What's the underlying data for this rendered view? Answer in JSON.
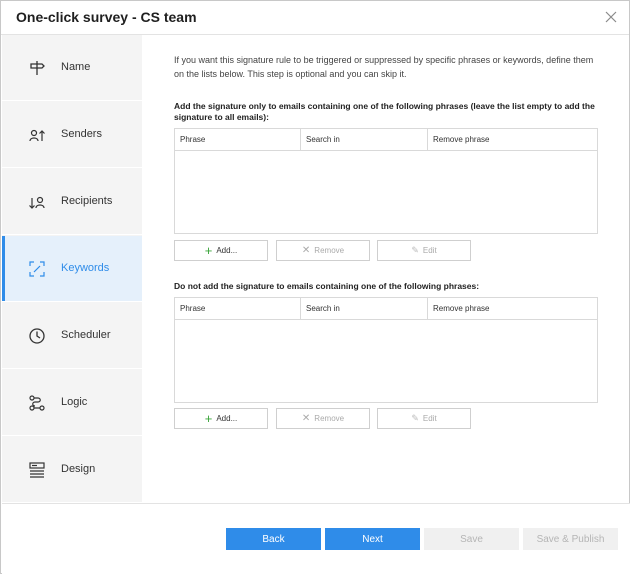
{
  "window": {
    "title": "One-click survey - CS team"
  },
  "sidebar": {
    "items": [
      {
        "label": "Name",
        "icon": "signpost-icon",
        "active": false
      },
      {
        "label": "Senders",
        "icon": "senders-icon",
        "active": false
      },
      {
        "label": "Recipients",
        "icon": "recipients-icon",
        "active": false
      },
      {
        "label": "Keywords",
        "icon": "keywords-icon",
        "active": true
      },
      {
        "label": "Scheduler",
        "icon": "clock-icon",
        "active": false
      },
      {
        "label": "Logic",
        "icon": "logic-icon",
        "active": false
      },
      {
        "label": "Design",
        "icon": "design-icon",
        "active": false
      }
    ]
  },
  "main": {
    "intro": "If you want this signature rule to be triggered or suppressed by specific phrases or keywords, define them on the lists below. This step is optional and you can skip it.",
    "include_section": {
      "title": "Add the signature only to emails containing one of the following phrases (leave the list empty to add the signature to all emails):",
      "columns": [
        "Phrase",
        "Search in",
        "Remove phrase"
      ],
      "buttons": {
        "add": "Add...",
        "remove": "Remove",
        "edit": "Edit"
      }
    },
    "exclude_section": {
      "title": "Do not add the signature to emails containing one of the following phrases:",
      "columns": [
        "Phrase",
        "Search in",
        "Remove phrase"
      ],
      "buttons": {
        "add": "Add...",
        "remove": "Remove",
        "edit": "Edit"
      }
    }
  },
  "footer": {
    "back": "Back",
    "next": "Next",
    "save": "Save",
    "save_publish": "Save & Publish"
  },
  "colors": {
    "accent": "#2f8ce9",
    "sidebar_bg": "#f4f4f4",
    "active_bg": "#e5f0fb"
  }
}
